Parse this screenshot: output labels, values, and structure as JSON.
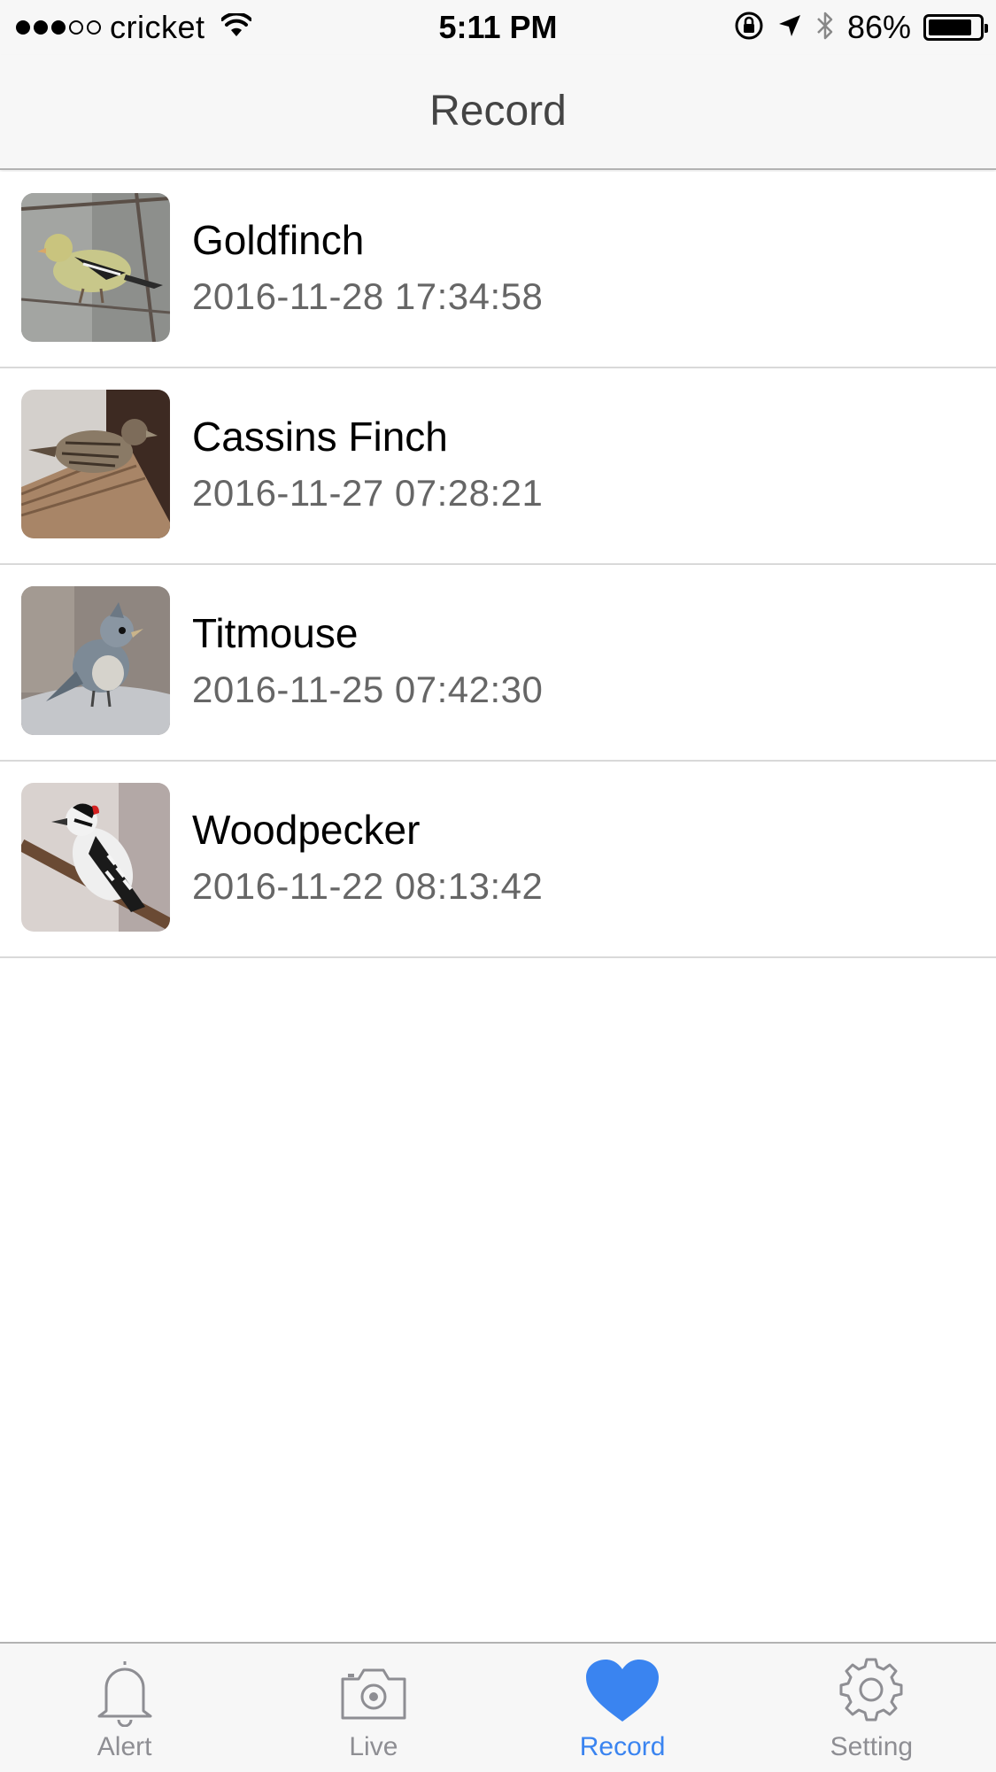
{
  "status_bar": {
    "carrier": "cricket",
    "time": "5:11 PM",
    "battery": "86%",
    "battery_level": 0.86,
    "icons": [
      "signal-dots",
      "wifi-icon",
      "orientation-lock-icon",
      "location-arrow-icon",
      "bluetooth-icon",
      "battery-icon"
    ]
  },
  "nav": {
    "title": "Record"
  },
  "records": [
    {
      "name": "Goldfinch",
      "timestamp": "2016-11-28 17:34:58"
    },
    {
      "name": "Cassins Finch",
      "timestamp": "2016-11-27 07:28:21"
    },
    {
      "name": "Titmouse",
      "timestamp": "2016-11-25 07:42:30"
    },
    {
      "name": "Woodpecker",
      "timestamp": "2016-11-22 08:13:42"
    }
  ],
  "tabs": [
    {
      "label": "Alert",
      "icon": "bell-icon",
      "active": false
    },
    {
      "label": "Live",
      "icon": "camera-icon",
      "active": false
    },
    {
      "label": "Record",
      "icon": "heart-icon",
      "active": true
    },
    {
      "label": "Setting",
      "icon": "gear-icon",
      "active": false
    }
  ],
  "colors": {
    "accent": "#3a84f0",
    "inactive": "#8e8e93",
    "bar_background": "#f7f7f7"
  }
}
